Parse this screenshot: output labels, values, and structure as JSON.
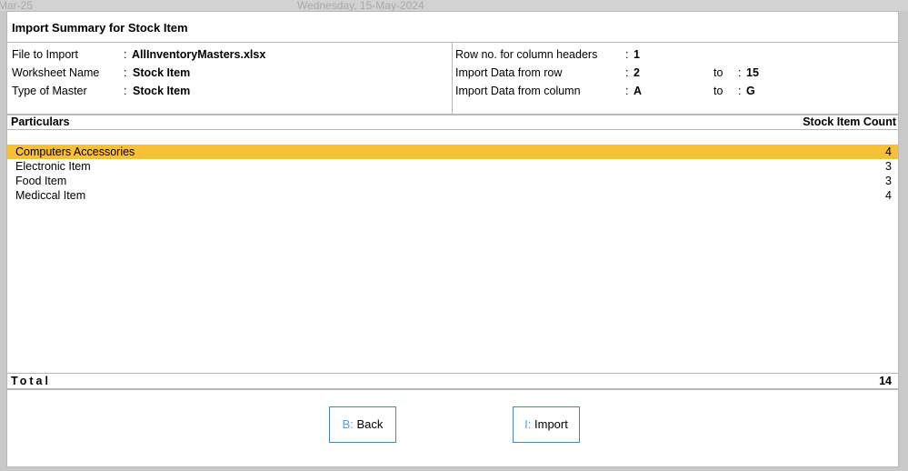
{
  "background": {
    "left_text": "Mar-25",
    "date_text": "Wednesday, 15-May-2024"
  },
  "title": "Import Summary for Stock Item",
  "info_left": [
    {
      "label": "File to Import",
      "value": "AllInventoryMasters.xlsx"
    },
    {
      "label": "Worksheet Name",
      "value": "Stock Item"
    },
    {
      "label": "Type of Master",
      "value": "Stock Item"
    }
  ],
  "info_right": {
    "header_row": {
      "label": "Row no. for column headers",
      "value": "1"
    },
    "data_row": {
      "label": "Import Data from row",
      "from": "2",
      "to_label": "to",
      "to": "15"
    },
    "data_col": {
      "label": "Import Data from column",
      "from": "A",
      "to_label": "to",
      "to": "G"
    }
  },
  "table": {
    "col_left": "Particulars",
    "col_right": "Stock Item Count",
    "rows": [
      {
        "name": "Computers Accessories",
        "count": "4",
        "selected": true
      },
      {
        "name": "Electronic Item",
        "count": "3"
      },
      {
        "name": "Food Item",
        "count": "3"
      },
      {
        "name": "Mediccal Item",
        "count": "4"
      }
    ],
    "total_label": "Total",
    "total_value": "14"
  },
  "buttons": {
    "back": {
      "key": "B:",
      "label": "Back"
    },
    "import": {
      "key": "I:",
      "label": "Import"
    }
  },
  "colors": {
    "selection": "#f8c033",
    "button_border": "#4a86b8",
    "button_key": "#5aa0d8"
  }
}
